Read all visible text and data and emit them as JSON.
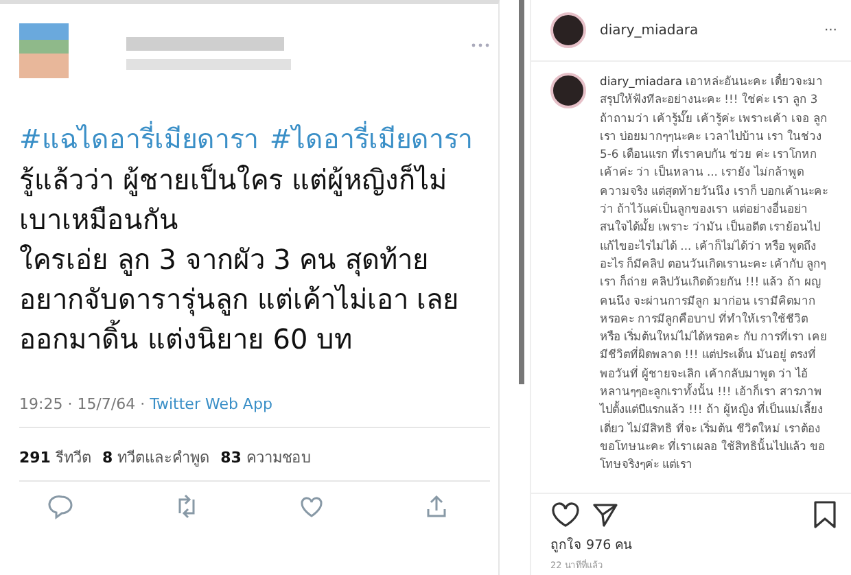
{
  "tweet": {
    "hashtags": [
      "#แฉไดอารี่เมียดารา",
      "#ไดอารี่เมียดารา"
    ],
    "body_lines": [
      "รู้แล้วว่า ผู้ชายเป็นใคร แต่ผู้หญิงก็ไม่",
      "เบาเหมือนกัน",
      "ใครเอ่ย ลูก 3 จากผัว 3 คน สุดท้าย",
      "อยากจับดารารุ่นลูก แต่เค้าไม่เอา เลย",
      "ออกมาดิ้น แต่งนิยาย 60 บท"
    ],
    "time": "19:25 · 15/7/64 · ",
    "source": "Twitter Web App",
    "stats": [
      {
        "count": "291",
        "label": "รีทวีต"
      },
      {
        "count": "8",
        "label": "ทวีตและคำพูด"
      },
      {
        "count": "83",
        "label": "ความชอบ"
      }
    ]
  },
  "instagram": {
    "username": "diary_miadara",
    "more": "···",
    "caption_user": "diary_miadara",
    "caption": "เอาหล่ะอันนะคะ เดี๋ยวจะมา สรุปให้ฟังทีละอย่างนะคะ !!! ใช่ค่ะ เรา ลูก 3 ถ้าถามว่า เค้ารู้มั๊ย เค้ารู้ค่ะ เพราะเค้า เจอ ลูกเรา บ่อยมากๆๆนะคะ เวลาไปบ้าน เรา ในช่วง 5-6 เดือนแรก ที่เราคบกัน ช่วย ค่ะ เราโกหกเค้าค่ะ ว่า เป็นหลาน ... เรายัง ไม่กล้าพูดความจริง แต่สุดท้ายวันนึง เราก็ บอกเค้านะคะ ว่า ถ้าไว้แค่เป็นลูกของเรา แต่อย่างอื่นอย่าสนใจได้มั้ย เพราะ ว่ามัน เป็นอดีต เราย้อนไปแก้ไขอะไรไม่ได้ ... เค้าก็ไม่ได้ว่า หรือ พูดถึงอะไร ก็มีคลิป ตอนวันเกิดเรานะคะ เค้ากับ ลูกๆเรา ก็ถ่าย คลิปวันเกิดด้วยกัน !!! แล้ว ถ้า ผญ คนนึง จะผ่านการมีลูก มาก่อน เรามีคิดมากหรอคะ การมีลูกคือบาป ที่ทำให้เราใช้ชีวิต หรือ เริ่มต้นใหม่ไม่ได้หรอคะ กับ การที่เรา เคยมีชีวิตที่ผิดพลาด !!! แต่ประเด็น มันอยู่ ตรงที่ พอวันที่ ผู้ชายจะเลิก เค้ากลับมาพูด ว่า ไอ้หลานๆๆอะลูกเราทั้งนั้น !!! เอ้าก็เรา สารภาพ ไปตั้งแต่ปีแรกแล้ว !!! ถ้า ผู้หญิง ที่เป็นแม่เลี้ยงเดี่ยว ไม่มีสิทธิ ที่จะ เริ่มต้น ชีวิตใหม่ เราต้องขอโทษนะคะ ที่เราเผลอ ใช้สิทธินั้นไปแล้ว ขอโทษจริงๆค่ะ แต่เรา",
    "likes": "ถูกใจ 976 คน",
    "time": "22 นาทีที่แล้ว"
  }
}
